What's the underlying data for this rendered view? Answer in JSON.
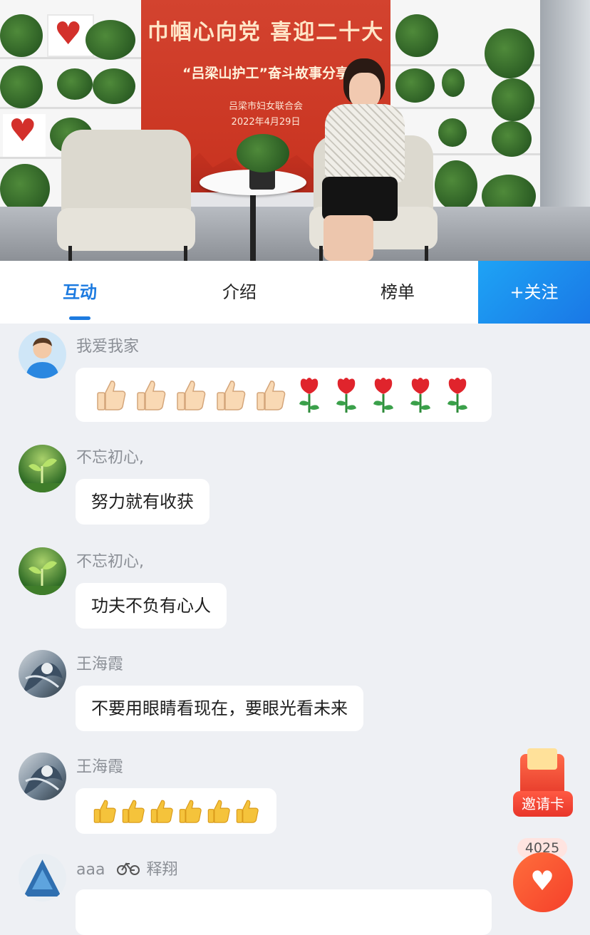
{
  "video": {
    "banner_line1": "巾帼心向党 喜迎二十大",
    "banner_line2": "“吕梁山护工”奋斗故事分享",
    "banner_org": "吕梁市妇女联合会",
    "banner_date": "2022年4月29日"
  },
  "tabs": {
    "items": [
      {
        "label": "互动"
      },
      {
        "label": "介绍"
      },
      {
        "label": "榜单"
      }
    ],
    "active": "互动",
    "follow_label": "+关注"
  },
  "messages": [
    {
      "user": "我爱我家",
      "avatar": "boy-avatar",
      "content": "5 thumbs-up, 5 roses",
      "emoji": {
        "thumbs_up": 5,
        "roses": 5
      }
    },
    {
      "user": "不忘初心,",
      "avatar": "sprout-avatar",
      "content": "努力就有收获"
    },
    {
      "user": "不忘初心,",
      "avatar": "sprout-avatar",
      "content": "功夫不负有心人"
    },
    {
      "user": "王海霞",
      "avatar": "artwork-avatar",
      "content": "不要用眼睛看现在，要眼光看未来"
    },
    {
      "user": "王海霞",
      "avatar": "artwork-avatar",
      "content": "6 thumbs-up",
      "emoji": {
        "thumbs_up": 6
      }
    },
    {
      "user": "aaa",
      "user_suffix": "释翔",
      "avatar": "triangle-avatar",
      "suffix_icon": "bicycle-icon"
    }
  ],
  "floating": {
    "invite_label": "邀请卡",
    "like_count": "4025",
    "like_icon": "heart-icon",
    "invite_icon": "red-envelope-icon"
  },
  "colors": {
    "accent": "#1d7be0",
    "follow_bg": "#1a78e6",
    "banner_red": "#c8321f",
    "chat_bg": "#eef0f4"
  }
}
